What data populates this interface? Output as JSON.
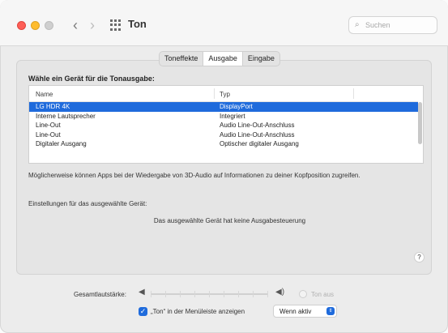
{
  "window": {
    "title": "Ton",
    "search_placeholder": "Suchen"
  },
  "tabs": [
    {
      "label": "Toneffekte",
      "active": false
    },
    {
      "label": "Ausgabe",
      "active": true
    },
    {
      "label": "Eingabe",
      "active": false
    }
  ],
  "output": {
    "heading": "Wähle ein Gerät für die Tonausgabe:",
    "columns": {
      "name": "Name",
      "type": "Typ"
    },
    "devices": [
      {
        "name": "LG HDR 4K",
        "type": "DisplayPort",
        "selected": true
      },
      {
        "name": "Interne Lautsprecher",
        "type": "Integriert",
        "selected": false
      },
      {
        "name": "Line-Out",
        "type": "Audio Line-Out-Anschluss",
        "selected": false
      },
      {
        "name": "Line-Out",
        "type": "Audio Line-Out-Anschluss",
        "selected": false
      },
      {
        "name": "Digitaler Ausgang",
        "type": "Optischer digitaler Ausgang",
        "selected": false
      }
    ],
    "info_text": "Möglicherweise können Apps bei der Wiedergabe von 3D-Audio auf Informationen zu deiner Kopfposition zugreifen.",
    "settings_label": "Einstellungen für das ausgewählte Gerät:",
    "no_control_text": "Das ausgewählte Gerät hat keine Ausgabesteuerung",
    "help_label": "?"
  },
  "footer": {
    "volume_label": "Gesamtlautstärke:",
    "mute_label": "Ton aus",
    "menubar_checkbox_label": "„Ton“ in der Menüleiste anzeigen",
    "menubar_checked": true,
    "menubar_option": "Wenn aktiv"
  },
  "colors": {
    "accent": "#1f6bdc",
    "close": "#fe5f57",
    "minimize": "#febc2e"
  }
}
